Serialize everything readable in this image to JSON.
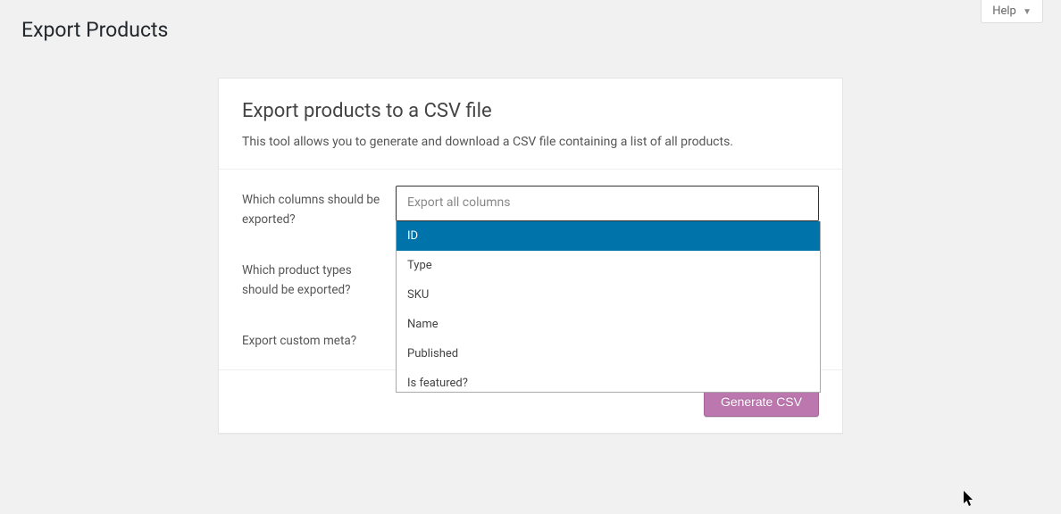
{
  "help": {
    "label": "Help"
  },
  "page_title": "Export Products",
  "panel": {
    "heading": "Export products to a CSV file",
    "description": "This tool allows you to generate and download a CSV file containing a list of all products."
  },
  "form": {
    "columns_label": "Which columns should be exported?",
    "columns_placeholder": "Export all columns",
    "types_label": "Which product types should be exported?",
    "meta_label": "Export custom meta?"
  },
  "dropdown": {
    "items": {
      "0": "ID",
      "1": "Type",
      "2": "SKU",
      "3": "Name",
      "4": "Published",
      "5": "Is featured?"
    }
  },
  "button": {
    "generate": "Generate CSV"
  }
}
